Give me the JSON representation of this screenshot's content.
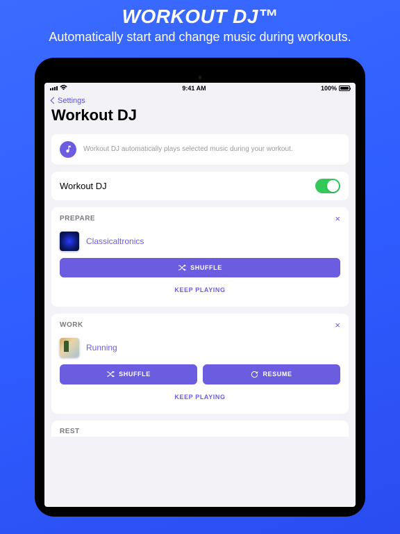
{
  "promo": {
    "title": "WORKOUT DJ™",
    "subtitle": "Automatically start and change music during workouts."
  },
  "statusbar": {
    "time": "9:41 AM",
    "battery": "100%"
  },
  "nav": {
    "back": "Settings",
    "title": "Workout DJ"
  },
  "info": {
    "text": "Workout DJ automatically plays selected music during your workout."
  },
  "toggle": {
    "label": "Workout DJ",
    "on": true
  },
  "sections": {
    "prepare": {
      "title": "PREPARE",
      "playlist": "Classicaltronics",
      "shuffle": "SHUFFLE",
      "keep": "KEEP PLAYING"
    },
    "work": {
      "title": "WORK",
      "playlist": "Running",
      "shuffle": "SHUFFLE",
      "resume": "RESUME",
      "keep": "KEEP PLAYING"
    },
    "rest": {
      "title": "REST"
    }
  },
  "colors": {
    "accent": "#6b5ce0",
    "toggle_on": "#34c759"
  }
}
